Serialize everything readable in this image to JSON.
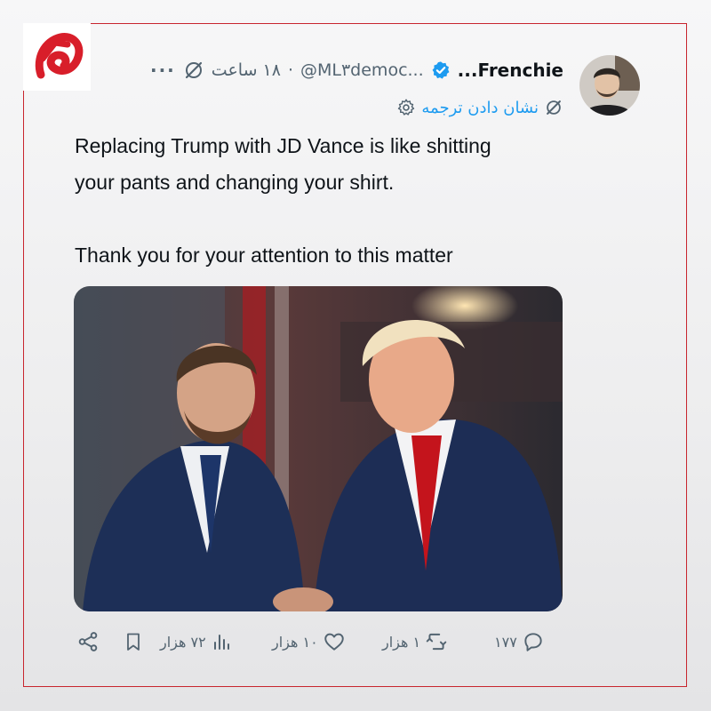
{
  "header": {
    "display_name": "Frenchie...",
    "handle": "@ML۳democ...",
    "separator": "·",
    "time": "۱۸ ساعت",
    "more": "···"
  },
  "translate": {
    "label": "نشان دادن ترجمه"
  },
  "tweet": {
    "text": "Replacing Trump with JD Vance is like shitting\nyour pants and changing your shirt.\n\nThank you for your attention to this matter"
  },
  "actions": {
    "replies": "۱۷۷",
    "retweets": "۱ هزار",
    "likes": "۱۰ هزار",
    "views": "۷۲ هزار"
  },
  "colors": {
    "frame_border": "#c8252e",
    "accent_blue": "#1d9bf0",
    "text_primary": "#0f1419",
    "text_secondary": "#536471"
  },
  "icons": {
    "logo": "brand-logo-icon",
    "verified": "verified-badge-icon",
    "grok": "grok-icon",
    "settings": "gear-icon",
    "reply": "reply-icon",
    "retweet": "retweet-icon",
    "like": "heart-icon",
    "views": "views-bar-icon",
    "bookmark": "bookmark-icon",
    "share": "share-icon"
  }
}
